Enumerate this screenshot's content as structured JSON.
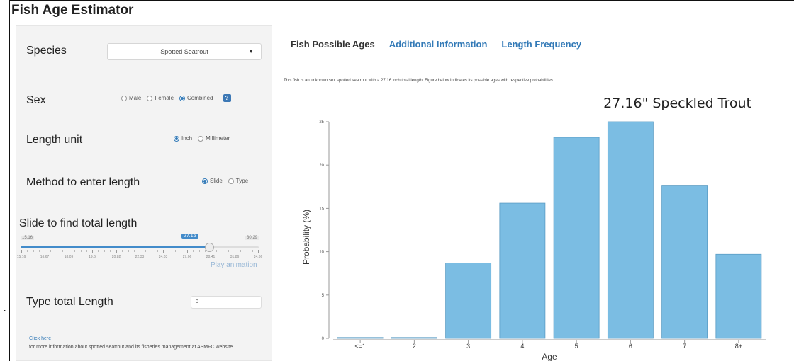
{
  "app": {
    "title": "Fish Age Estimator"
  },
  "stray": ".",
  "sidebar": {
    "species": {
      "label": "Species",
      "selected": "Spotted Seatrout"
    },
    "sex": {
      "label": "Sex",
      "options": [
        "Male",
        "Female",
        "Combined"
      ],
      "selected": "Combined",
      "help_label": "?"
    },
    "length_unit": {
      "label": "Length unit",
      "options": [
        "Inch",
        "Millimeter"
      ],
      "selected": "Inch"
    },
    "method": {
      "label": "Method to enter length",
      "options": [
        "Slide",
        "Type"
      ],
      "selected": "Slide"
    },
    "slider": {
      "label": "Slide to find total length",
      "min_label": "15.16",
      "max_label": "30.29",
      "value_label": "27.16",
      "min": 15.16,
      "max": 30.29,
      "value": 27.16,
      "tick_labels": [
        "15.16",
        "16.67",
        "18.09",
        "19.6",
        "20.82",
        "22.33",
        "24.03",
        "27.06",
        "28.41",
        "31.86",
        "24.36"
      ],
      "play_label": "Play animation"
    },
    "type_length": {
      "label": "Type total Length",
      "value": "0"
    },
    "info": {
      "link": "Click here",
      "text": "for more information about spotted seatrout and its fisheries management at ASMFC website."
    }
  },
  "main": {
    "tabs": [
      {
        "label": "Fish Possible Ages",
        "active": true
      },
      {
        "label": "Additional Information",
        "active": false
      },
      {
        "label": "Length Frequency",
        "active": false
      }
    ],
    "description": "This fish is an unknown sex spotted seatrout with a 27.16 inch total length. Figure below indicates its possible ages with respective probabilities."
  },
  "colors": {
    "accent": "#337ab7",
    "bar": "#7bbde3",
    "bar_stroke": "#5a9cc4"
  },
  "chart_data": {
    "type": "bar",
    "title": "27.16\" Speckled Trout",
    "xlabel": "Age",
    "ylabel": "Probability (%)",
    "categories": [
      "<=1",
      "2",
      "3",
      "4",
      "5",
      "6",
      "7",
      "8+"
    ],
    "values": [
      0.1,
      0.1,
      8.7,
      15.6,
      23.2,
      25.0,
      17.6,
      9.7
    ],
    "ylim": [
      0,
      25
    ],
    "yticks": [
      0,
      5,
      10,
      15,
      20,
      25
    ],
    "grid": false,
    "legend": false
  }
}
